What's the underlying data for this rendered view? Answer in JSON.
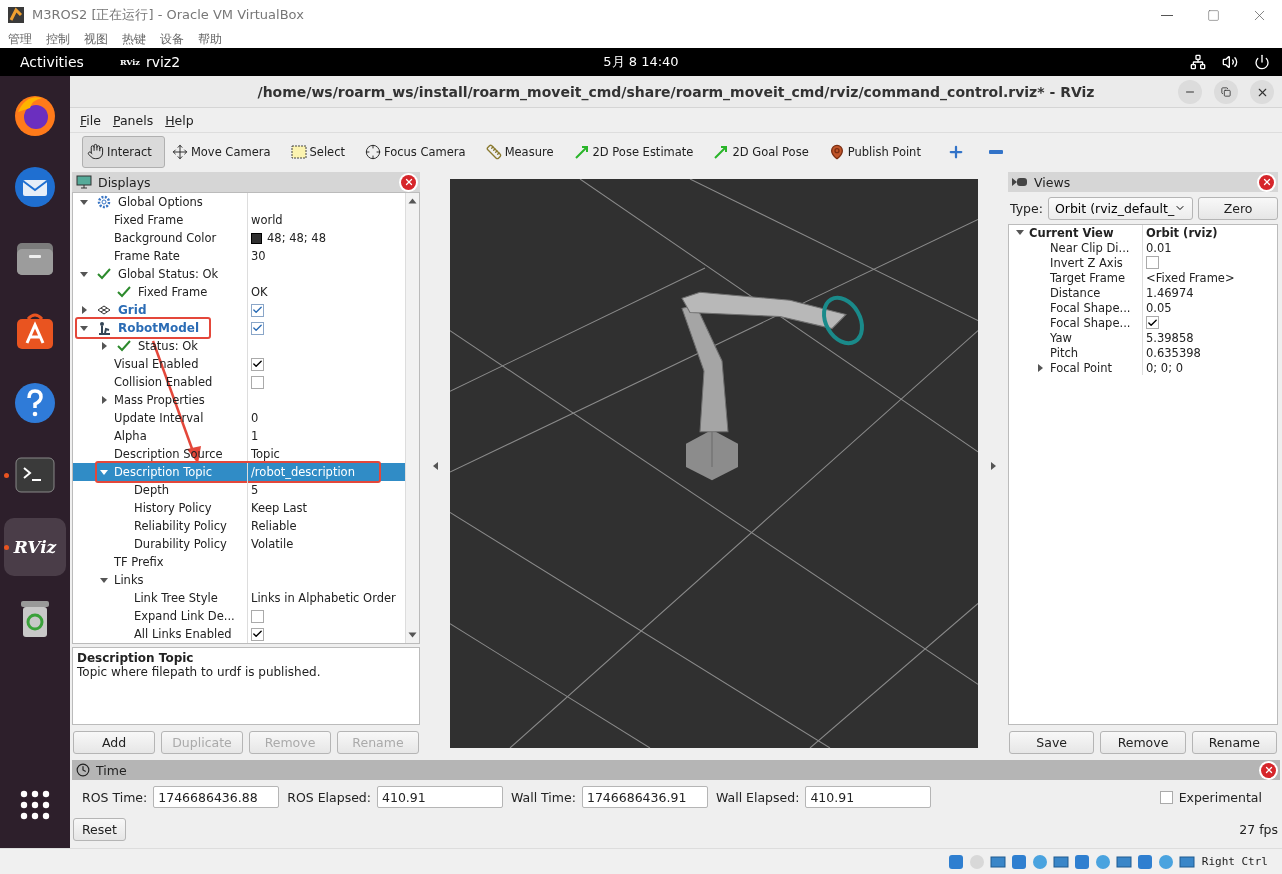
{
  "vbox": {
    "title": "M3ROS2 [正在运行] - Oracle VM VirtualBox",
    "menu": [
      "管理",
      "控制",
      "视图",
      "热键",
      "设备",
      "帮助"
    ],
    "host_key": "Right Ctrl"
  },
  "topbar": {
    "activities": "Activities",
    "app_logo": "RViz",
    "app": "rviz2",
    "clock": "5月 8  14:40"
  },
  "dock": [
    {
      "kind": "browser",
      "running": false,
      "active": false
    },
    {
      "kind": "mail",
      "running": false,
      "active": false
    },
    {
      "kind": "files",
      "running": false,
      "active": false
    },
    {
      "kind": "store",
      "running": false,
      "active": false
    },
    {
      "kind": "help",
      "running": false,
      "active": false
    },
    {
      "kind": "terminal",
      "running": true,
      "active": false
    },
    {
      "kind": "rviz",
      "running": true,
      "active": true,
      "label": "RViz"
    },
    {
      "kind": "trash",
      "running": false,
      "active": false
    },
    {
      "kind": "apps",
      "running": false,
      "active": false
    }
  ],
  "rviz": {
    "title": "/home/ws/roarm_ws/install/roarm_moveit_cmd/share/roarm_moveit_cmd/rviz/command_control.rviz* - RViz",
    "menu": [
      "File",
      "Panels",
      "Help"
    ],
    "toolbar": [
      {
        "kind": "interact",
        "label": "Interact",
        "selected": true
      },
      {
        "kind": "move",
        "label": "Move Camera",
        "selected": false
      },
      {
        "kind": "select",
        "label": "Select",
        "selected": false
      },
      {
        "kind": "focus",
        "label": "Focus Camera",
        "selected": false
      },
      {
        "kind": "measure",
        "label": "Measure",
        "selected": false
      },
      {
        "kind": "pose",
        "label": "2D Pose Estimate",
        "selected": false
      },
      {
        "kind": "goal",
        "label": "2D Goal Pose",
        "selected": false
      },
      {
        "kind": "point",
        "label": "Publish Point",
        "selected": false
      },
      {
        "kind": "add",
        "selected": false
      },
      {
        "kind": "remove",
        "selected": false
      }
    ],
    "displays": {
      "title": "Displays",
      "tree": [
        {
          "kind": "options",
          "label": "Global Options",
          "expanded": true,
          "selected": false,
          "children": [
            {
              "kind": "property",
              "label": "Fixed Frame",
              "value": "world",
              "selected": false
            },
            {
              "kind": "property",
              "label": "Background Color",
              "value": "48; 48; 48",
              "color": "#303030",
              "selected": false
            },
            {
              "kind": "property",
              "label": "Frame Rate",
              "value": "30",
              "selected": false
            }
          ]
        },
        {
          "kind": "status",
          "label": "Global Status: Ok",
          "expanded": true,
          "selected": false,
          "children": [
            {
              "kind": "status",
              "label": "Fixed Frame",
              "value": "OK",
              "selected": false
            }
          ]
        },
        {
          "kind": "display",
          "label": "Grid",
          "expanded": false,
          "checked": true,
          "selected": false
        },
        {
          "kind": "display",
          "label": "RobotModel",
          "expanded": true,
          "checked": true,
          "selected": false,
          "highlighted": true,
          "children": [
            {
              "kind": "status",
              "label": "Status: Ok",
              "expanded": false,
              "selected": false
            },
            {
              "kind": "property",
              "label": "Visual Enabled",
              "checked": true,
              "selected": false
            },
            {
              "kind": "property",
              "label": "Collision Enabled",
              "checked": false,
              "selected": false
            },
            {
              "kind": "property",
              "label": "Mass Properties",
              "expanded": false,
              "selected": false
            },
            {
              "kind": "property",
              "label": "Update Interval",
              "value": "0",
              "selected": false
            },
            {
              "kind": "property",
              "label": "Alpha",
              "value": "1",
              "selected": false
            },
            {
              "kind": "property",
              "label": "Description Source",
              "value": "Topic",
              "selected": false
            },
            {
              "kind": "property",
              "label": "Description Topic",
              "value": "/robot_description",
              "expanded": true,
              "selected": true,
              "highlighted": true,
              "children": [
                {
                  "kind": "property",
                  "label": "Depth",
                  "value": "5",
                  "selected": false
                },
                {
                  "kind": "property",
                  "label": "History Policy",
                  "value": "Keep Last",
                  "selected": false
                },
                {
                  "kind": "property",
                  "label": "Reliability Policy",
                  "value": "Reliable",
                  "selected": false
                },
                {
                  "kind": "property",
                  "label": "Durability Policy",
                  "value": "Volatile",
                  "selected": false
                }
              ]
            },
            {
              "kind": "property",
              "label": "TF Prefix",
              "selected": false
            },
            {
              "kind": "property",
              "label": "Links",
              "expanded": true,
              "selected": false,
              "children": [
                {
                  "kind": "property",
                  "label": "Link Tree Style",
                  "value": "Links in Alphabetic Order",
                  "selected": false
                },
                {
                  "kind": "property",
                  "label": "Expand Link De...",
                  "checked": false,
                  "selected": false
                },
                {
                  "kind": "property",
                  "label": "All Links Enabled",
                  "checked": true,
                  "selected": false
                }
              ]
            }
          ]
        }
      ],
      "description": {
        "title": "Description Topic",
        "text": "Topic where filepath to urdf is published."
      },
      "buttons": [
        {
          "label": "Add",
          "disabled": false
        },
        {
          "label": "Duplicate",
          "disabled": true
        },
        {
          "label": "Remove",
          "disabled": true
        },
        {
          "label": "Rename",
          "disabled": true
        }
      ]
    },
    "views": {
      "title": "Views",
      "type_label": "Type:",
      "type_value": "Orbit (rviz_default_",
      "zero": "Zero",
      "tree": [
        {
          "kind": "group",
          "label": "Current View",
          "value": "Orbit (rviz)",
          "expanded": true,
          "selected": false,
          "children": [
            {
              "kind": "property",
              "label": "Near Clip Di...",
              "value": "0.01",
              "selected": false
            },
            {
              "kind": "property",
              "label": "Invert Z Axis",
              "checked": false,
              "selected": false
            },
            {
              "kind": "property",
              "label": "Target Frame",
              "value": "<Fixed Frame>",
              "selected": false
            },
            {
              "kind": "property",
              "label": "Distance",
              "value": "1.46974",
              "selected": false
            },
            {
              "kind": "property",
              "label": "Focal Shape...",
              "value": "0.05",
              "selected": false
            },
            {
              "kind": "property",
              "label": "Focal Shape...",
              "checked": true,
              "selected": false
            },
            {
              "kind": "property",
              "label": "Yaw",
              "value": "5.39858",
              "selected": false
            },
            {
              "kind": "property",
              "label": "Pitch",
              "value": "0.635398",
              "selected": false
            },
            {
              "kind": "property",
              "label": "Focal Point",
              "value": "0; 0; 0",
              "expanded": false,
              "selected": false
            }
          ]
        }
      ],
      "buttons": [
        {
          "label": "Save",
          "disabled": false
        },
        {
          "label": "Remove",
          "disabled": false
        },
        {
          "label": "Rename",
          "disabled": false
        }
      ]
    },
    "time": {
      "title": "Time",
      "fields": [
        {
          "label": "ROS Time:",
          "value": "1746686436.88"
        },
        {
          "label": "ROS Elapsed:",
          "value": "410.91"
        },
        {
          "label": "Wall Time:",
          "value": "1746686436.91"
        },
        {
          "label": "Wall Elapsed:",
          "value": "410.91"
        }
      ],
      "experimental": {
        "label": "Experimental",
        "checked": false
      },
      "reset": "Reset",
      "fps": "27 fps"
    }
  }
}
